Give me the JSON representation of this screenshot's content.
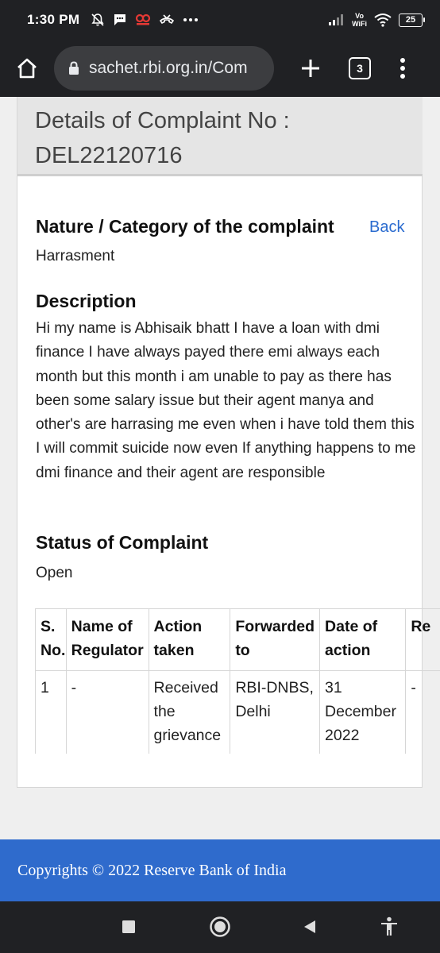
{
  "status_bar": {
    "time": "1:30 PM",
    "battery": "25",
    "icons": [
      "bell-off-icon",
      "message-icon",
      "app-notification-icon",
      "call-icon",
      "more-dots-icon",
      "signal-icon",
      "vowifi-icon",
      "wifi-icon",
      "battery-icon"
    ],
    "vowifi_top": "Vo",
    "vowifi_bottom": "WiFi"
  },
  "browser": {
    "url": "sachet.rbi.org.in/Com",
    "tab_count": "3"
  },
  "page": {
    "title_line1": "Details of Complaint No :",
    "title_line2": "DEL22120716",
    "category_heading": "Nature / Category of the complaint",
    "back_label": "Back",
    "category_value": "Harrasment",
    "description_heading": "Description",
    "description_text": "Hi my name is Abhisaik bhatt I have a loan with dmi finance I have always payed there emi always each month but this month i am unable to pay as there has been some salary issue but their agent manya and other's are harrasing me even when i have told them this I will commit suicide now even If anything happens to me dmi finance and their agent are responsible",
    "status_heading": "Status of Complaint",
    "status_value": "Open"
  },
  "table": {
    "headers": [
      "S. No.",
      "Name of Regulator",
      "Action taken",
      "Forwarded to",
      "Date of action",
      "Re"
    ],
    "rows": [
      [
        "1",
        "-",
        "Received the grievance",
        "RBI-DNBS, Delhi",
        "31 December 2022",
        "-"
      ]
    ]
  },
  "footer": {
    "text": "Copyrights © 2022 Reserve Bank of India"
  },
  "nav": {
    "icons": [
      "recents-square-icon",
      "home-circle-icon",
      "back-triangle-icon",
      "accessibility-icon"
    ]
  }
}
